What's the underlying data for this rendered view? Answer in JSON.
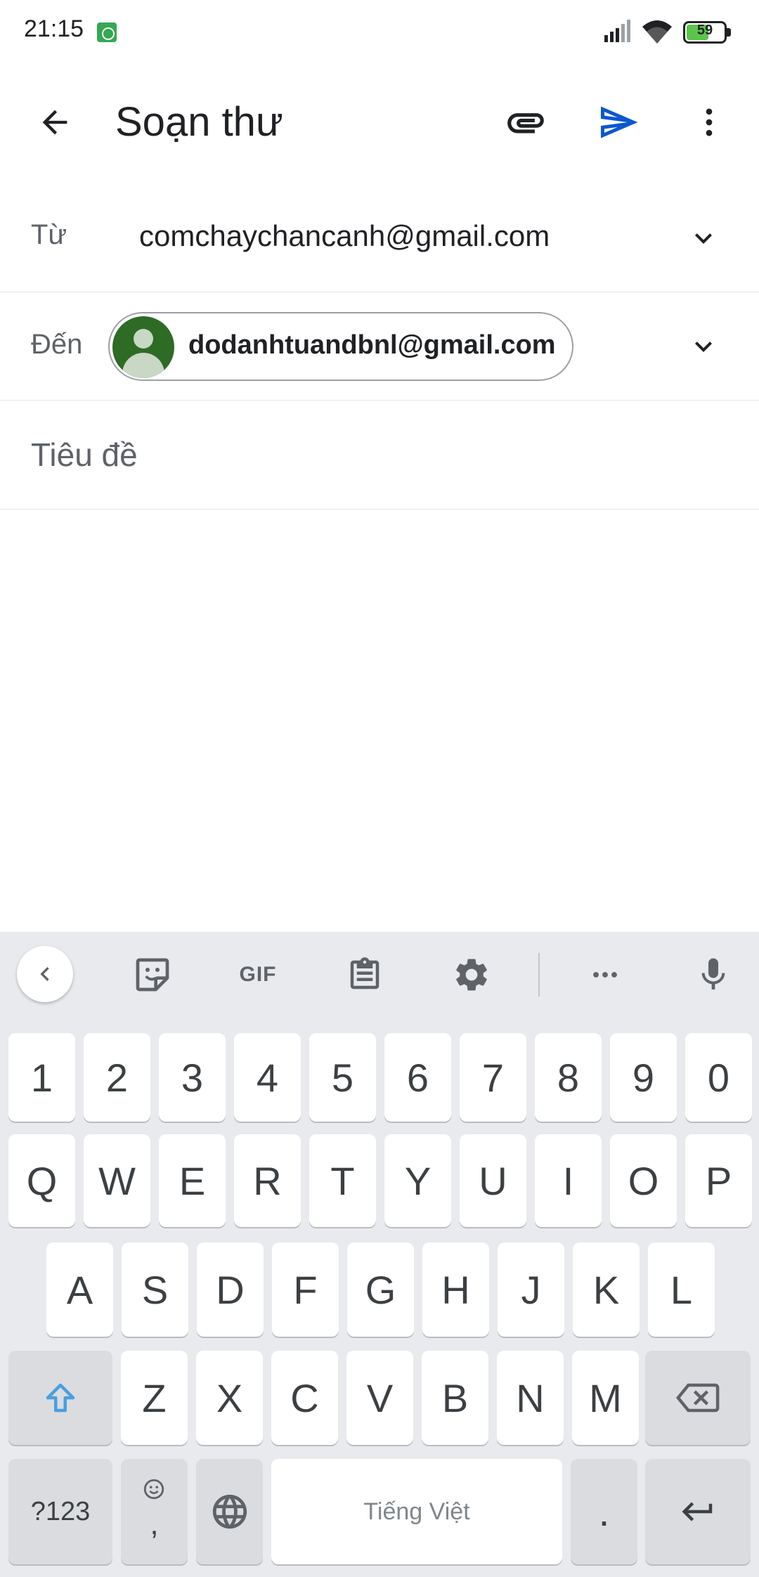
{
  "status_bar": {
    "time": "21:15",
    "battery_level": "59",
    "battery_fraction": 0.59,
    "app_icon": "cat-notification-icon",
    "icons": [
      "signal-icon",
      "wifi-icon",
      "battery-icon"
    ]
  },
  "top_bar": {
    "title": "Soạn thư",
    "back_icon": "arrow-back-icon",
    "attach_icon": "paperclip-icon",
    "send_icon": "send-icon",
    "more_icon": "more-vert-icon"
  },
  "compose": {
    "from_label": "Từ",
    "from_value": "comchaychancanh@gmail.com",
    "to_label": "Đến",
    "to_chip": "dodanhtuandbnl@gmail.com",
    "subject_placeholder": "Tiêu đề"
  },
  "keyboard": {
    "toolbar": {
      "collapse_icon": "chevron-left-icon",
      "sticker_icon": "sticker-icon",
      "gif_label": "GIF",
      "clipboard_icon": "clipboard-icon",
      "settings_icon": "gear-icon",
      "more_icon": "more-horiz-icon",
      "mic_icon": "mic-icon"
    },
    "number_row": [
      "1",
      "2",
      "3",
      "4",
      "5",
      "6",
      "7",
      "8",
      "9",
      "0"
    ],
    "row1": [
      "Q",
      "W",
      "E",
      "R",
      "T",
      "Y",
      "U",
      "I",
      "O",
      "P"
    ],
    "row2": [
      "A",
      "S",
      "D",
      "F",
      "G",
      "H",
      "J",
      "K",
      "L"
    ],
    "row3": [
      "Z",
      "X",
      "C",
      "V",
      "B",
      "N",
      "M"
    ],
    "symbols_label": "?123",
    "comma_label": ",",
    "space_label": "Tiếng Việt",
    "period_label": ".",
    "accent_color": "#4a9ee0"
  }
}
